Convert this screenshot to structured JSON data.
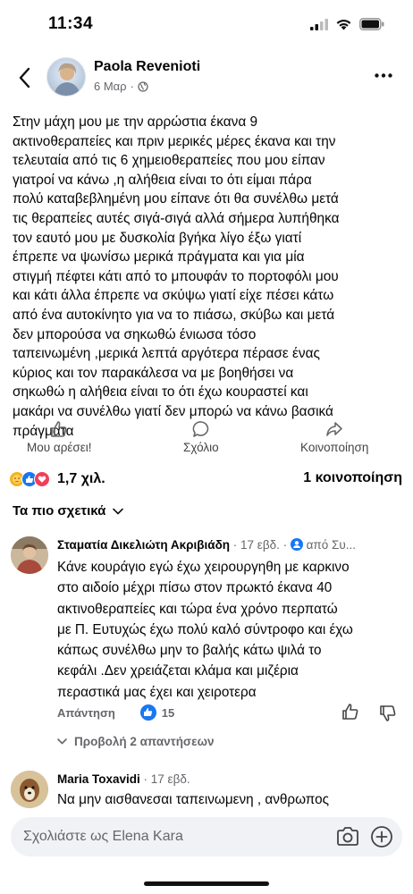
{
  "status_bar": {
    "time": "11:34"
  },
  "post": {
    "author": "Paola Revenioti",
    "date": "6 Μαρ",
    "separator": "·",
    "text": "Στην μάχη μου με την αρρώστια έκανα 9\nακτινοθεραπείες και πριν μερικές μέρες έκανα και την\nτελευταία από τις 6 χημειοθεραπείες που μου είπαν\nγιατροί να κάνω ,η αλήθεια είναι το ότι είμαι πάρα\nπολύ καταβεβλημένη μου είπανε ότι θα συνέλθω μετά\nτις θεραπείες αυτές σιγά-σιγά αλλά σήμερα λυπήθηκα\nτον εαυτό μου με δυσκολία βγήκα λίγο έξω γιατί\nέπρεπε να ψωνίσω μερικά πράγματα και για μία\nστιγμή πέφτει κάτι από το μπουφάν το πορτοφόλι μου\nκαι κάτι άλλα έπρεπε να σκύψω γιατί είχε πέσει κάτω\nαπό ένα αυτοκίνητο για να το πιάσω, σκύβω και μετά\nδεν μπορούσα να σηκωθώ ένιωσα τόσο\nταπεινωμένη ,μερικά λεπτά αργότερα πέρασε ένας\nκύριος και τον παρακάλεσα να με βοηθήσει να\nσηκωθώ  η αλήθεια είναι το ότι έχω κουραστεί και\nμακάρι να συνέλθω γιατί δεν μπορώ να κάνω βασικά\nπράγματα"
  },
  "actions": {
    "like": "Μου αρέσει!",
    "comment": "Σχόλιο",
    "share": "Κοινοποίηση"
  },
  "reactions": {
    "count": "1,7 χιλ.",
    "shares": "1 κοινοποίηση"
  },
  "sort": {
    "label": "Τα πιο σχετικά"
  },
  "comments": [
    {
      "author": "Σταματία Δικελιώτη Ακριβιάδη",
      "meta": "· 17 εβδ. ·",
      "from": "από Συ...",
      "text": "Κάνε κουράγιο εγώ έχω χειρουργηθη με καρκινο\nστο αιδοίο μέχρι πίσω στον πρωκτό έκανα 40\nακτινοθεραπείες και τώρα ένα χρόνο περπατώ\nμε Π. Ευτυχώς έχω πολύ καλό σύντροφο και έχω\nκάπως συνέλθω μην το βαλής κάτω ψιλά το\nκεφάλι .Δεν χρειάζεται κλάμα και μιζέρια\nπεραστικά μας έχει και χειροτερα",
      "reply_label": "Απάντηση",
      "likes": "15",
      "view_replies": "Προβολή 2 απαντήσεων"
    },
    {
      "author": "Maria Toxavidi",
      "meta": "· 17 εβδ.",
      "text": "Να μην αισθανεσαι ταπεινωμενη , ανθρωπος"
    }
  ],
  "composer": {
    "placeholder": "Σχολιάστε ως Elena Kara"
  },
  "colors": {
    "accent": "#1877f2",
    "secondary_text": "#65676b",
    "love": "#f33e58",
    "care": "#f7b125"
  }
}
